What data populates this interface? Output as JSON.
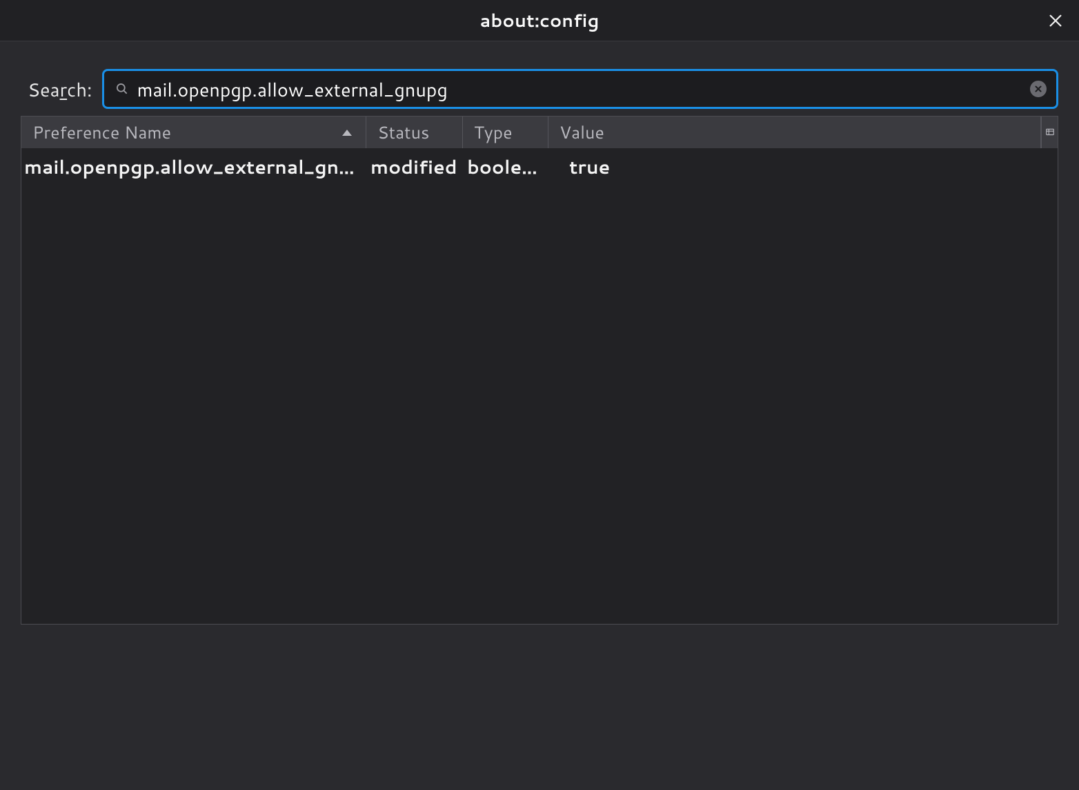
{
  "window": {
    "title": "about:config"
  },
  "search": {
    "label_pre": "Sea",
    "label_underline": "r",
    "label_post": "ch:",
    "value": "mail.openpgp.allow_external_gnupg"
  },
  "columns": {
    "name": "Preference Name",
    "status": "Status",
    "type": "Type",
    "value": "Value"
  },
  "rows": [
    {
      "name": "mail.openpgp.allow_external_gnupg",
      "status": "modified",
      "type": "boolean",
      "value": "true"
    }
  ]
}
